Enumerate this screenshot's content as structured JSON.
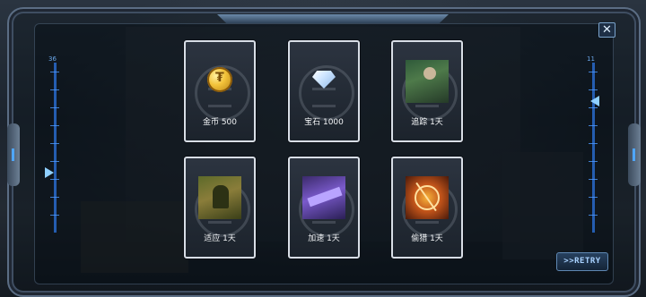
{
  "gauges": {
    "left": {
      "label": "36"
    },
    "right": {
      "label": "11"
    }
  },
  "buttons": {
    "close_glyph": "✕",
    "retry_label": ">>RETRY"
  },
  "rewards": [
    {
      "name": "金币 500",
      "icon": "gold-coin-icon"
    },
    {
      "name": "宝石 1000",
      "icon": "diamond-gem-icon"
    },
    {
      "name": "追踪 1天",
      "icon": "track-skill-icon"
    },
    {
      "name": "适应 1天",
      "icon": "adapt-skill-icon"
    },
    {
      "name": "加速 1天",
      "icon": "speed-skill-icon"
    },
    {
      "name": "偷猎 1天",
      "icon": "poach-skill-icon"
    }
  ],
  "colors": {
    "accent_blue": "#4f9bff",
    "card_border": "#d8dee6",
    "coin_gold": "#f3c33a"
  }
}
